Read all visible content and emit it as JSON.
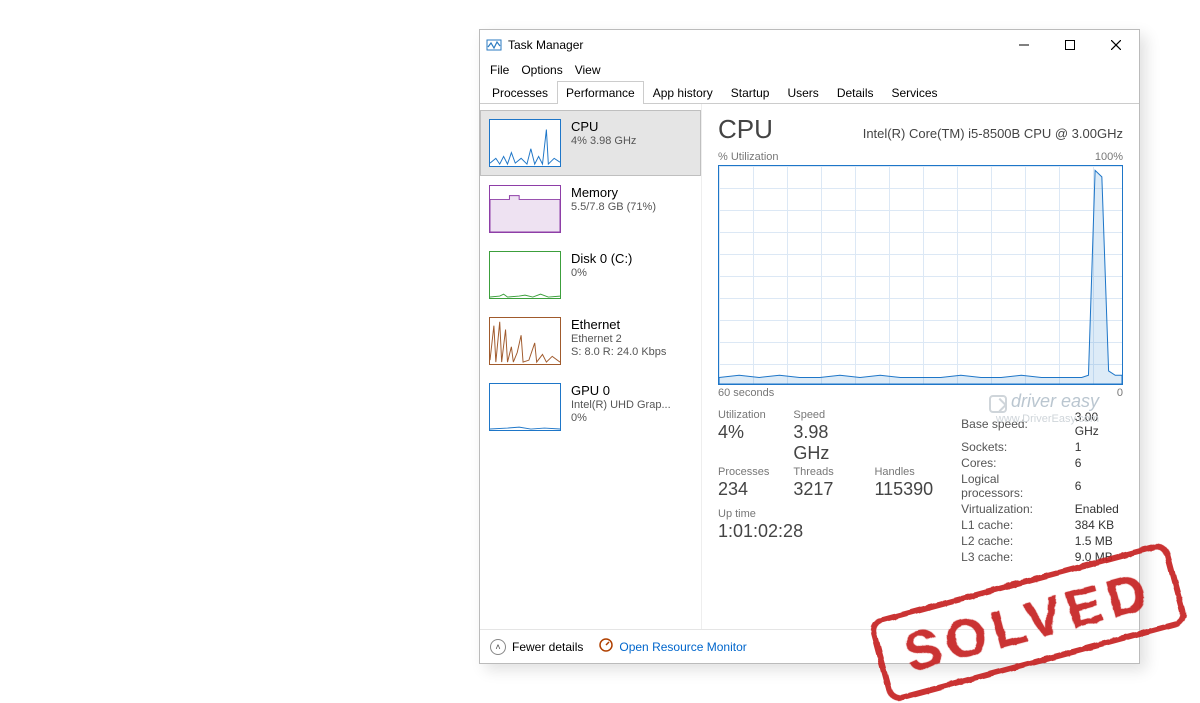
{
  "window": {
    "title": "Task Manager",
    "menu": [
      "File",
      "Options",
      "View"
    ],
    "tabs": [
      "Processes",
      "Performance",
      "App history",
      "Startup",
      "Users",
      "Details",
      "Services"
    ],
    "active_tab_index": 1
  },
  "sidebar": {
    "items": [
      {
        "title": "CPU",
        "sub": "4%  3.98 GHz",
        "kind": "cpu",
        "selected": true
      },
      {
        "title": "Memory",
        "sub": "5.5/7.8 GB (71%)",
        "kind": "memory",
        "selected": false
      },
      {
        "title": "Disk 0 (C:)",
        "sub": "0%",
        "kind": "disk",
        "selected": false
      },
      {
        "title": "Ethernet",
        "sub": "Ethernet 2",
        "sub2": "S: 8.0  R: 24.0 Kbps",
        "kind": "eth",
        "selected": false
      },
      {
        "title": "GPU 0",
        "sub": "Intel(R) UHD Grap...",
        "sub2": "0%",
        "kind": "gpu",
        "selected": false
      }
    ]
  },
  "detail": {
    "heading": "CPU",
    "hardware": "Intel(R) Core(TM) i5-8500B CPU @ 3.00GHz",
    "chart_top_left": "% Utilization",
    "chart_top_right": "100%",
    "chart_bottom_left": "60 seconds",
    "chart_bottom_right": "0",
    "grid": {
      "utilization_label": "Utilization",
      "utilization": "4%",
      "speed_label": "Speed",
      "speed": "3.98 GHz",
      "processes_label": "Processes",
      "processes": "234",
      "threads_label": "Threads",
      "threads": "3217",
      "handles_label": "Handles",
      "handles": "115390",
      "uptime_label": "Up time",
      "uptime": "1:01:02:28"
    },
    "right": [
      {
        "k": "Base speed:",
        "v": "3.00 GHz"
      },
      {
        "k": "Sockets:",
        "v": "1"
      },
      {
        "k": "Cores:",
        "v": "6"
      },
      {
        "k": "Logical processors:",
        "v": "6"
      },
      {
        "k": "Virtualization:",
        "v": "Enabled"
      },
      {
        "k": "L1 cache:",
        "v": "384 KB"
      },
      {
        "k": "L2 cache:",
        "v": "1.5 MB"
      },
      {
        "k": "L3 cache:",
        "v": "9.0 MB"
      }
    ]
  },
  "footer": {
    "fewer": "Fewer details",
    "resource_monitor": "Open Resource Monitor"
  },
  "chart_data": {
    "type": "area",
    "title": "% Utilization",
    "xlabel": "seconds ago",
    "ylabel": "% Utilization",
    "xlim": [
      60,
      0
    ],
    "ylim": [
      0,
      100
    ],
    "x": [
      60,
      57,
      54,
      51,
      48,
      45,
      42,
      39,
      36,
      33,
      30,
      27,
      24,
      21,
      18,
      15,
      12,
      9,
      6,
      5,
      4,
      3,
      2,
      1,
      0
    ],
    "values": [
      3,
      4,
      3,
      4,
      3,
      3,
      4,
      3,
      4,
      3,
      3,
      3,
      4,
      3,
      3,
      4,
      3,
      3,
      3,
      4,
      98,
      95,
      6,
      4,
      4
    ]
  },
  "watermark": {
    "brand": "driver easy",
    "site": "www.DriverEasy.com"
  },
  "stamp": {
    "text": "SOLVED"
  }
}
